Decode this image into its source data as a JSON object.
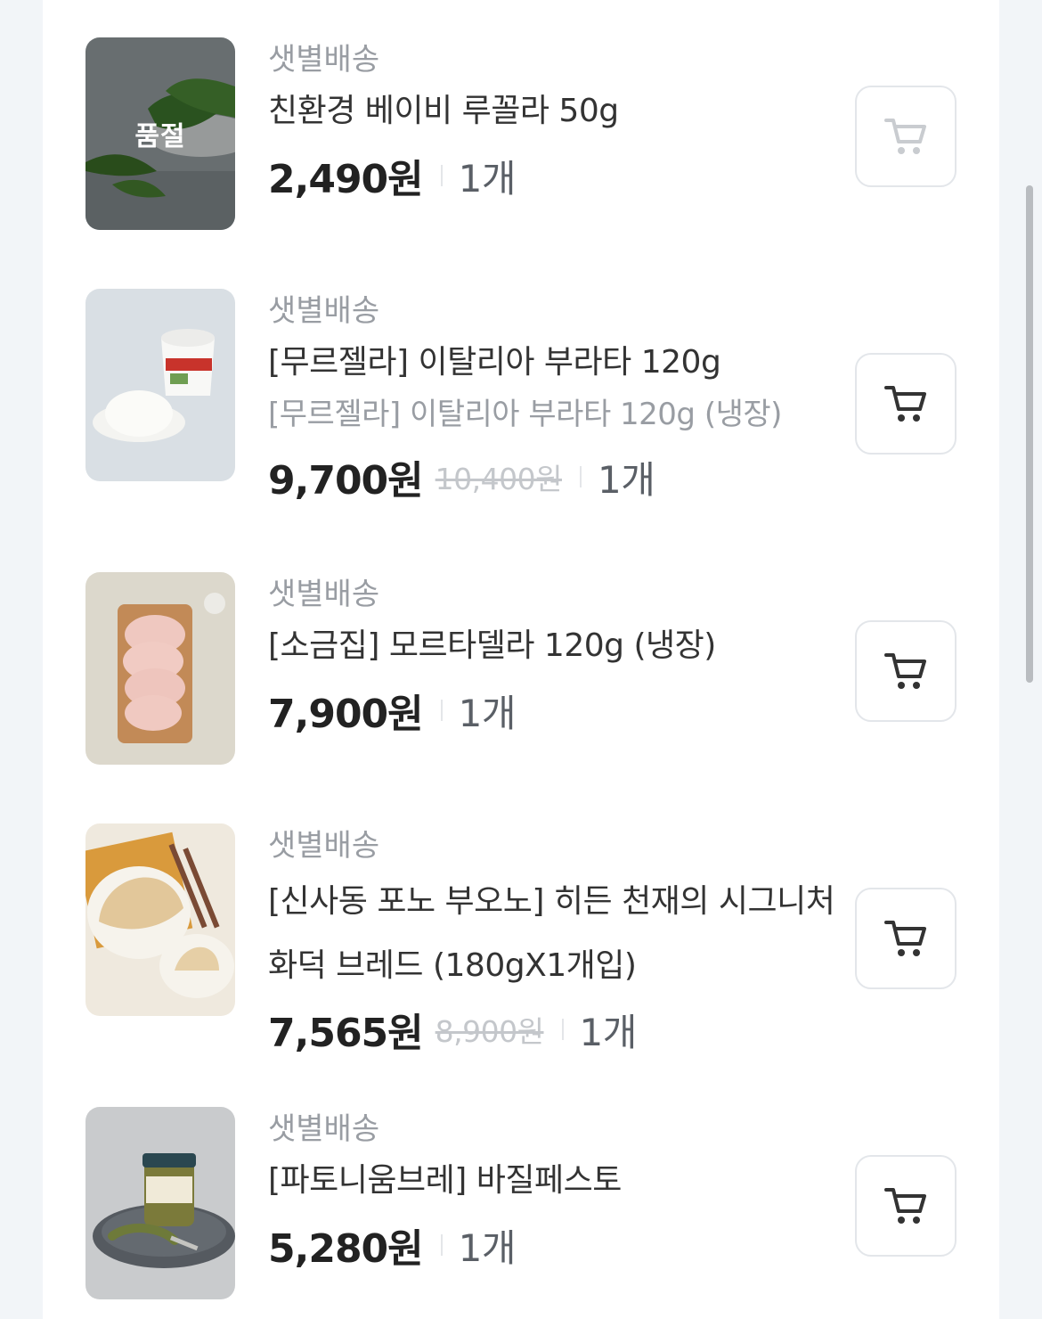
{
  "products": [
    {
      "delivery": "샛별배송",
      "name": "친환경 베이비 루꼴라 50g",
      "subname": "",
      "price": "2,490원",
      "original_price": "",
      "quantity": "1개",
      "badge": "품절",
      "sold_out": true,
      "cart_icon": "cart-icon"
    },
    {
      "delivery": "샛별배송",
      "name": "[무르젤라] 이탈리아 부라타 120g",
      "subname": "[무르젤라] 이탈리아 부라타 120g (냉장)",
      "price": "9,700원",
      "original_price": "10,400원",
      "quantity": "1개",
      "badge": "",
      "sold_out": false,
      "cart_icon": "cart-icon"
    },
    {
      "delivery": "샛별배송",
      "name": "[소금집] 모르타델라 120g (냉장)",
      "subname": "",
      "price": "7,900원",
      "original_price": "",
      "quantity": "1개",
      "badge": "",
      "sold_out": false,
      "cart_icon": "cart-icon"
    },
    {
      "delivery": "샛별배송",
      "name": "[신사동 포노 부오노] 히든 천재의 시그니처 화덕 브레드 (180gX1개입)",
      "subname": "",
      "price": "7,565원",
      "original_price": "8,900원",
      "quantity": "1개",
      "badge": "",
      "sold_out": false,
      "cart_icon": "cart-icon"
    },
    {
      "delivery": "샛별배송",
      "name": "[파토니움브레] 바질페스토",
      "subname": "",
      "price": "5,280원",
      "original_price": "",
      "quantity": "1개",
      "badge": "",
      "sold_out": false,
      "cart_icon": "cart-icon"
    }
  ],
  "colors": {
    "page_background": "#f2f5f8",
    "card_background": "#ffffff",
    "price_text": "#222222",
    "muted_text": "#999da3",
    "strike_text": "#c4c7cb",
    "cart_active": "#333333",
    "cart_disabled": "#c9ccd0"
  }
}
